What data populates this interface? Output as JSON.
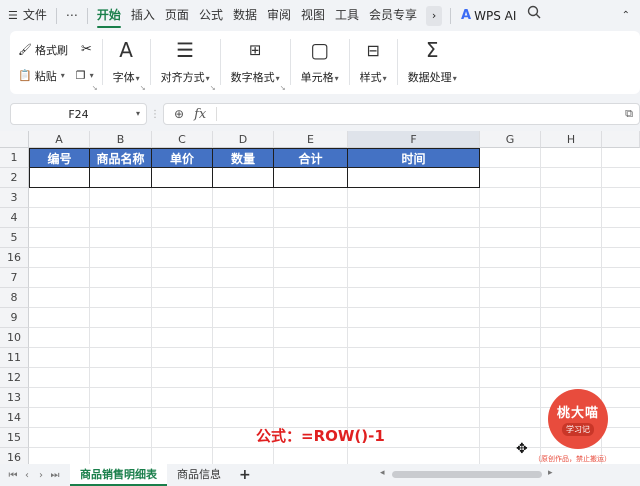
{
  "menu": {
    "file": "文件",
    "more": "⋯",
    "tabs": [
      "开始",
      "插入",
      "页面",
      "公式",
      "数据",
      "审阅",
      "视图",
      "工具",
      "会员专享"
    ],
    "active_index": 0,
    "wps_ai": "WPS AI"
  },
  "ribbon": {
    "format_painter": "格式刷",
    "paste": "粘贴",
    "font": "字体",
    "align": "对齐方式",
    "number_format": "数字格式",
    "cell": "单元格",
    "style": "样式",
    "data_process": "数据处理"
  },
  "formula_bar": {
    "cell_ref": "F24",
    "fx": "fx"
  },
  "grid": {
    "columns": [
      "A",
      "B",
      "C",
      "D",
      "E",
      "F",
      "G",
      "H"
    ],
    "selected_column": "F",
    "rows": [
      "1",
      "2",
      "3",
      "4",
      "5",
      "16",
      "7",
      "8",
      "9",
      "10",
      "11",
      "12",
      "13",
      "14",
      "15",
      "16"
    ],
    "header_cells": [
      "编号",
      "商品名称",
      "单价",
      "数量",
      "合计",
      "时间"
    ],
    "header_fill": "#4472c4"
  },
  "annotation": {
    "formula_text": "公式：=ROW()-1",
    "color": "#e02020"
  },
  "watermark": {
    "name": "桃大喵",
    "sub": "学习记",
    "note": "（原创作品，禁止搬运）"
  },
  "sheets": {
    "tabs": [
      "商品销售明细表",
      "商品信息"
    ],
    "active_index": 0,
    "add": "+"
  }
}
